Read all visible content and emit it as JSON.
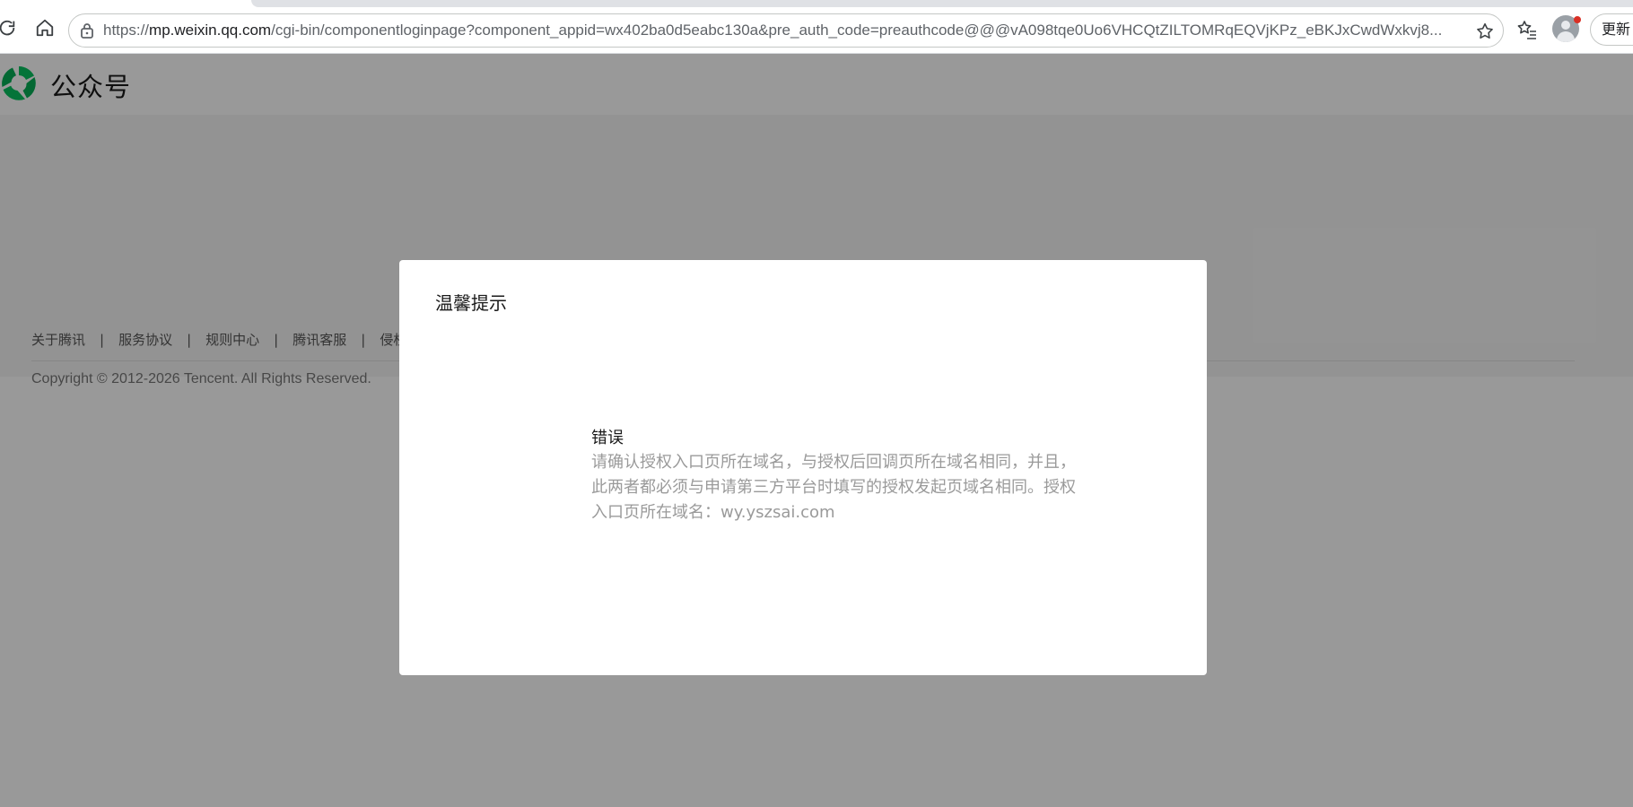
{
  "browser": {
    "url_prefix": "https://",
    "url_host": "mp.weixin.qq.com",
    "url_path": "/cgi-bin/componentloginpage?component_appid=wx402ba0d5eabc130a&pre_auth_code=preauthcode@@@vA098tqe0Uo6VHCQtZILTOMRqEQVjKPz_eBKJxCwdWxkvj8...",
    "update_label": "更新",
    "icons": [
      "reload-icon",
      "home-icon",
      "lock-icon",
      "star-icon",
      "favorites-icon",
      "avatar-icon"
    ],
    "colors": {
      "notification_dot": "#d93025"
    }
  },
  "header": {
    "logo_text": "公众号",
    "colors": {
      "logo_green": "#07c160"
    }
  },
  "footer": {
    "links": [
      "关于腾讯",
      "服务协议",
      "规则中心",
      "腾讯客服",
      "侵权"
    ],
    "separator": "|",
    "copyright": "Copyright © 2012-2026 Tencent. All Rights Reserved."
  },
  "dialog": {
    "title": "温馨提示",
    "message_title": "错误",
    "message_text": "请确认授权入口页所在域名，与授权后回调页所在域名相同，并且，此两者都必须与申请第三方平台时填写的授权发起页域名相同。授权入口页所在域名：wy.yszsai.com"
  }
}
